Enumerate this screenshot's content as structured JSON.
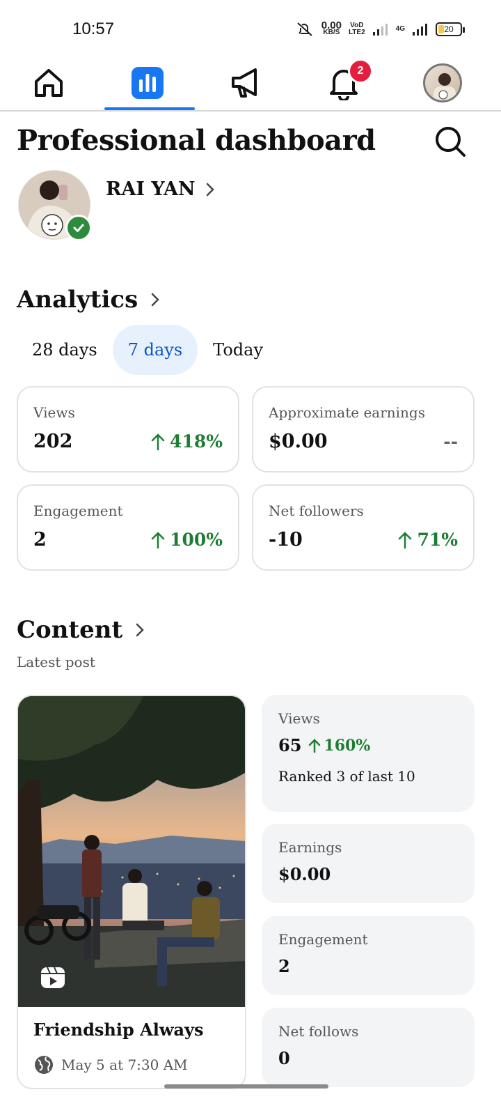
{
  "status_bar": {
    "time": "10:57",
    "speed_value": "0.00",
    "speed_unit": "KB/S",
    "volte_top": "VoD",
    "volte_bottom": "LTE2",
    "network": "4G",
    "battery": "20"
  },
  "nav": {
    "notification_count": "2"
  },
  "header": {
    "title": "Professional dashboard"
  },
  "profile": {
    "name": "RAI YAN"
  },
  "analytics": {
    "title": "Analytics",
    "tabs": [
      "28 days",
      "7 days",
      "Today"
    ],
    "active_tab": "7 days",
    "cards": [
      {
        "label": "Views",
        "value": "202",
        "change": "418%"
      },
      {
        "label": "Approximate earnings",
        "value": "$0.00",
        "change": "--"
      },
      {
        "label": "Engagement",
        "value": "2",
        "change": "100%"
      },
      {
        "label": "Net followers",
        "value": "-10",
        "change": "71%"
      }
    ]
  },
  "content": {
    "title": "Content",
    "subtitle": "Latest post",
    "post": {
      "title": "Friendship Always",
      "date": "May 5 at 7:30 AM"
    },
    "metrics": {
      "views_label": "Views",
      "views_value": "65",
      "views_change": "160%",
      "views_rank": "Ranked 3 of last 10",
      "earnings_label": "Earnings",
      "earnings_value": "$0.00",
      "engagement_label": "Engagement",
      "engagement_value": "2",
      "follows_label": "Net follows",
      "follows_value": "0"
    }
  },
  "colors": {
    "accent": "#1877f2",
    "positive": "#1e7d32",
    "badge": "#e41e3f"
  }
}
